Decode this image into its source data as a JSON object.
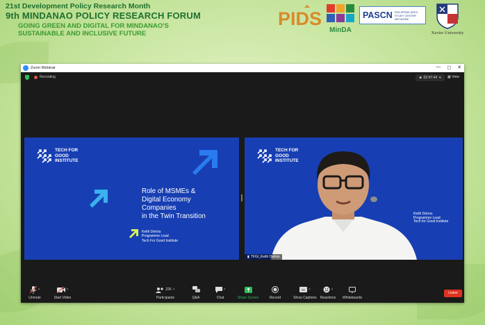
{
  "header": {
    "line1": "21st Development Policy Research Month",
    "line2": "9th MINDANAO POLICY RESEARCH FORUM",
    "line3a": "GOING GREEN AND DIGITAL FOR MINDANAO'S",
    "line3b": "SUSTAINABLE AND INCLUSIVE FUTURE"
  },
  "logos": {
    "pids": "PIDS",
    "minda": "MinDA",
    "pascn": "PASCN",
    "pascn_sub": "PHILIPPINE APEC STUDY CENTER NETWORK",
    "xu": "Xavier University"
  },
  "zoom": {
    "window_title": "Zoom Webinar",
    "recording_label": "Recording",
    "timer": "02:47:44",
    "view_label": "View",
    "slide": {
      "org": [
        "TECH FOR",
        "GOOD",
        "INSTITUTE"
      ],
      "title_lines": [
        "Role of MSMEs &",
        "Digital Economy",
        "Companies",
        "in the Twin Transition"
      ],
      "presenter_name": "Keith Detros",
      "presenter_role": "Programme Lead",
      "presenter_org": "Tech For Good Institute"
    },
    "video": {
      "org": [
        "TECH FOR",
        "GOOD",
        "INSTITUTE"
      ],
      "speaker_name": "Keith Detros",
      "speaker_role": "Programme Lead",
      "speaker_org": "Tech for Good Institute",
      "participant_label": "TFGI_Keith Detros"
    },
    "toolbar": {
      "unmute": "Unmute",
      "start_video": "Start Video",
      "participants": "Participants",
      "participants_count": "226",
      "qa": "Q&A",
      "chat": "Chat",
      "share_screen": "Share Screen",
      "record": "Record",
      "show_captions": "Show Captions",
      "reactions": "Reactions",
      "whiteboards": "Whiteboards",
      "leave": "Leave"
    },
    "colors": {
      "slide_bg": "#173fb3",
      "accent_blue": "#2a7bf0",
      "highlight_yellow": "#d9f25a",
      "share_green": "#2bbd5a",
      "leave_red": "#e0321f"
    }
  }
}
